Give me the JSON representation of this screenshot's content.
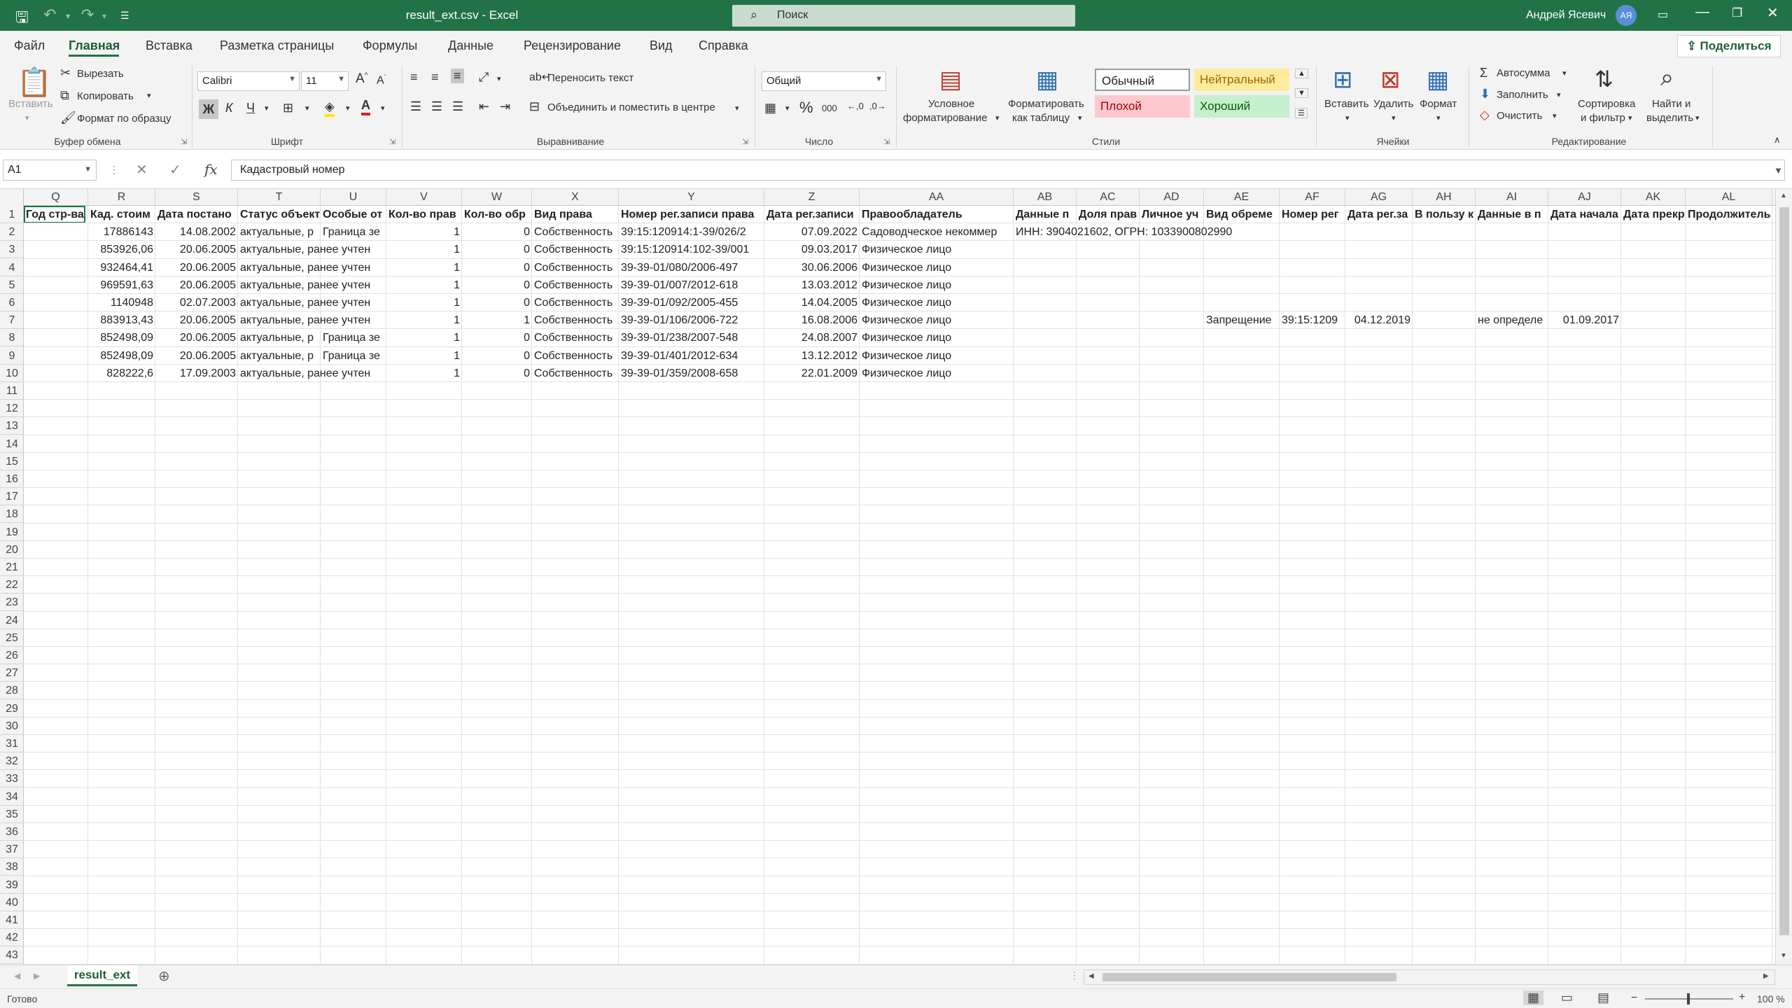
{
  "window": {
    "title": "result_ext.csv  -  Excel",
    "search_placeholder": "Поиск",
    "user_name": "Андрей Ясевич",
    "user_initials": "АЯ"
  },
  "tabs": [
    "Файл",
    "Главная",
    "Вставка",
    "Разметка страницы",
    "Формулы",
    "Данные",
    "Рецензирование",
    "Вид",
    "Справка"
  ],
  "share_label": "Поделиться",
  "ribbon": {
    "clipboard": {
      "paste": "Вставить",
      "cut": "Вырезать",
      "copy": "Копировать",
      "format_painter": "Формат по образцу",
      "group": "Буфер обмена"
    },
    "font": {
      "name": "Calibri",
      "size": "11",
      "bold": "Ж",
      "italic": "К",
      "underline": "Ч",
      "group": "Шрифт"
    },
    "alignment": {
      "wrap": "Переносить текст",
      "merge": "Объединить и поместить в центре",
      "group": "Выравнивание"
    },
    "number": {
      "format": "Общий",
      "percent": "%",
      "thousands": "000",
      "group": "Число"
    },
    "styles": {
      "conditional_1": "Условное",
      "conditional_2": "форматирование",
      "as_table_1": "Форматировать",
      "as_table_2": "как таблицу",
      "normal": "Обычный",
      "neutral": "Нейтральный",
      "bad": "Плохой",
      "good": "Хороший",
      "group": "Стили"
    },
    "cells": {
      "insert": "Вставить",
      "delete": "Удалить",
      "format": "Формат",
      "group": "Ячейки"
    },
    "editing": {
      "autosum": "Автосумма",
      "fill": "Заполнить",
      "clear": "Очистить",
      "sort_1": "Сортировка",
      "sort_2": "и фильтр",
      "find_1": "Найти и",
      "find_2": "выделить",
      "group": "Редактирование"
    }
  },
  "formula_bar": {
    "name_box": "A1",
    "fx": "fx",
    "value": "Кадастровый номер"
  },
  "columns": [
    "Q",
    "R",
    "S",
    "T",
    "U",
    "V",
    "W",
    "X",
    "Y",
    "Z",
    "AA",
    "AB",
    "AC",
    "AD",
    "AE",
    "AF",
    "AG",
    "AH",
    "AI",
    "AJ",
    "AK",
    "AL",
    "A"
  ],
  "row_numbers": [
    "1",
    "2",
    "3",
    "4",
    "5",
    "6",
    "7",
    "8",
    "9",
    "10",
    "11",
    "12",
    "13",
    "14",
    "15",
    "16",
    "17",
    "18",
    "19",
    "20",
    "21",
    "22",
    "23",
    "24",
    "25",
    "26",
    "27",
    "28",
    "29",
    "30",
    "31",
    "32",
    "33",
    "34",
    "35",
    "36",
    "37",
    "38",
    "39",
    "40",
    "41",
    "42",
    "43"
  ],
  "headers": [
    "Год стр-ва",
    "Кад. стоим",
    "Дата постано",
    "Статус объект",
    "Особые от",
    "Кол-во прав",
    "Кол-во обр",
    "Вид права",
    "Номер рег.записи права",
    "Дата рег.записи",
    "Правообладатель",
    "Данные п",
    "Доля прав",
    "Личное уч",
    "Вид обреме",
    "Номер рег",
    "Дата рег.за",
    "В пользу к",
    "Данные в п",
    "Дата начала",
    "Дата прекр",
    "Продолжитель"
  ],
  "rows": [
    [
      "",
      "17886143",
      "14.08.2002",
      "актуальные, р",
      "Граница зе",
      "1",
      "0",
      "Собственность",
      "39:15:120914:1-39/026/2",
      "07.09.2022",
      "Садоводческое некоммер",
      "ИНН: 3904021602, ОГРН: 1033900802990",
      "",
      "",
      "",
      "",
      "",
      "",
      "",
      "",
      "",
      ""
    ],
    [
      "",
      "853926,06",
      "20.06.2005",
      "актуальные, ранее учтен",
      "",
      "1",
      "0",
      "Собственность",
      "39:15:120914:102-39/001",
      "09.03.2017",
      "Физическое лицо",
      "",
      "",
      "",
      "",
      "",
      "",
      "",
      "",
      "",
      "",
      ""
    ],
    [
      "",
      "932464,41",
      "20.06.2005",
      "актуальные, ранее учтен",
      "",
      "1",
      "0",
      "Собственность",
      "39-39-01/080/2006-497",
      "30.06.2006",
      "Физическое лицо",
      "",
      "",
      "",
      "",
      "",
      "",
      "",
      "",
      "",
      "",
      ""
    ],
    [
      "",
      "969591,63",
      "20.06.2005",
      "актуальные, ранее учтен",
      "",
      "1",
      "0",
      "Собственность",
      "39-39-01/007/2012-618",
      "13.03.2012",
      "Физическое лицо",
      "",
      "",
      "",
      "",
      "",
      "",
      "",
      "",
      "",
      "",
      ""
    ],
    [
      "",
      "1140948",
      "02.07.2003",
      "актуальные, ранее учтен",
      "",
      "1",
      "0",
      "Собственность",
      "39-39-01/092/2005-455",
      "14.04.2005",
      "Физическое лицо",
      "",
      "",
      "",
      "",
      "",
      "",
      "",
      "",
      "",
      "",
      ""
    ],
    [
      "",
      "883913,43",
      "20.06.2005",
      "актуальные, ранее учтен",
      "",
      "1",
      "1",
      "Собственность",
      "39-39-01/106/2006-722",
      "16.08.2006",
      "Физическое лицо",
      "",
      "",
      "",
      "Запрещение",
      "39:15:1209",
      "04.12.2019",
      "",
      "не определе",
      "01.09.2017",
      "",
      ""
    ],
    [
      "",
      "852498,09",
      "20.06.2005",
      "актуальные, р",
      "Граница зе",
      "1",
      "0",
      "Собственность",
      "39-39-01/238/2007-548",
      "24.08.2007",
      "Физическое лицо",
      "",
      "",
      "",
      "",
      "",
      "",
      "",
      "",
      "",
      "",
      ""
    ],
    [
      "",
      "852498,09",
      "20.06.2005",
      "актуальные, р",
      "Граница зе",
      "1",
      "0",
      "Собственность",
      "39-39-01/401/2012-634",
      "13.12.2012",
      "Физическое лицо",
      "",
      "",
      "",
      "",
      "",
      "",
      "",
      "",
      "",
      "",
      ""
    ],
    [
      "",
      "828222,6",
      "17.09.2003",
      "актуальные, ранее учтен",
      "",
      "1",
      "0",
      "Собственность",
      "39-39-01/359/2008-658",
      "22.01.2009",
      "Физическое лицо",
      "",
      "",
      "",
      "",
      "",
      "",
      "",
      "",
      "",
      "",
      ""
    ]
  ],
  "sheet_tab": "result_ext",
  "status": {
    "ready": "Готово",
    "zoom": "100 %"
  }
}
